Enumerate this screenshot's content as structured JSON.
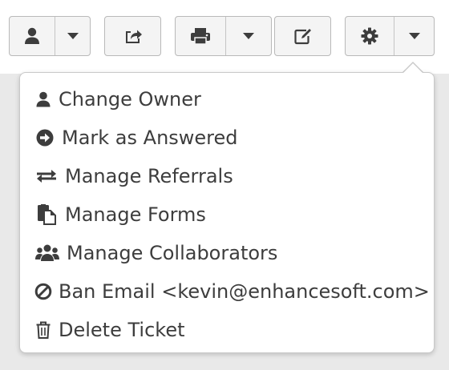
{
  "toolbar": {
    "buttons": [
      {
        "name": "user-assign-button",
        "icon": "user-icon",
        "has_dropdown": true
      },
      {
        "name": "share-button",
        "icon": "share-icon",
        "has_dropdown": false
      },
      {
        "name": "print-button",
        "icon": "print-icon",
        "has_dropdown": true
      },
      {
        "name": "edit-button",
        "icon": "edit-icon",
        "has_dropdown": false
      },
      {
        "name": "settings-button",
        "icon": "gear-icon",
        "has_dropdown": true
      }
    ]
  },
  "menu": {
    "items": [
      {
        "label": "Change Owner",
        "icon": "user-icon"
      },
      {
        "label": "Mark as Answered",
        "icon": "arrow-circle-right-icon"
      },
      {
        "label": "Manage Referrals",
        "icon": "exchange-icon"
      },
      {
        "label": "Manage Forms",
        "icon": "paste-icon"
      },
      {
        "label": "Manage Collaborators",
        "icon": "group-icon"
      },
      {
        "label": "Ban Email <kevin@enhancesoft.com>",
        "icon": "ban-icon"
      },
      {
        "label": "Delete Ticket",
        "icon": "trash-icon"
      }
    ]
  },
  "colors": {
    "icon": "#3d3d3d",
    "text": "#3d3d3d",
    "button_bg": "#f4f4f4",
    "button_border": "#b9b9b9",
    "page_bg": "#e9e9e9"
  }
}
